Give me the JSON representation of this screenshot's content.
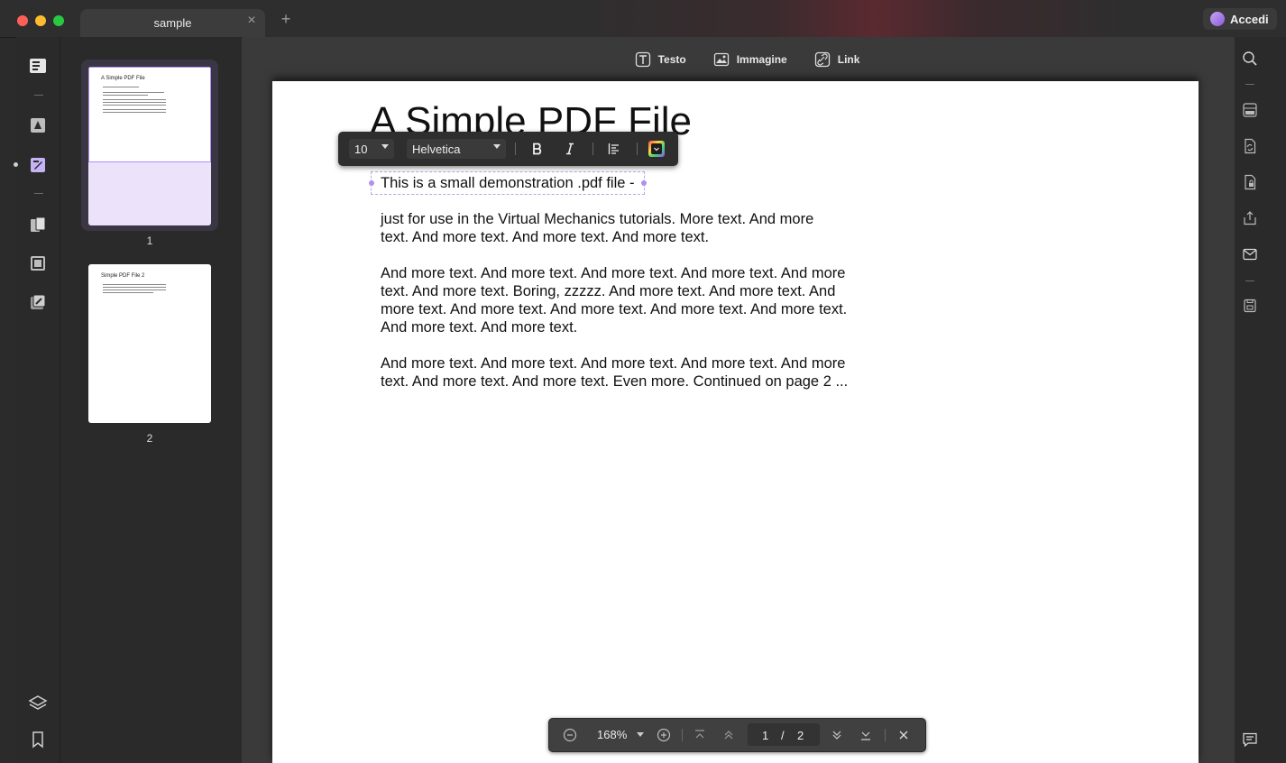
{
  "window": {
    "tab_title": "sample",
    "login_label": "Accedi"
  },
  "toolbar": {
    "text_label": "Testo",
    "image_label": "Immagine",
    "link_label": "Link"
  },
  "thumbnails": [
    {
      "number": "1",
      "title": "A Simple PDF File"
    },
    {
      "number": "2",
      "title": "Simple PDF File 2"
    }
  ],
  "format_bar": {
    "font_size": "10",
    "font_family": "Helvetica",
    "accent_color": "#e040fb"
  },
  "document": {
    "title": "A Simple PDF File",
    "selected_line": "This is a small demonstration .pdf file -",
    "paragraph1_line1": "just for use in the Virtual Mechanics tutorials. More text. And more",
    "paragraph1_line2": "text. And more text. And more text. And more text.",
    "paragraph2_line1": "And more text. And more text. And more text. And more text. And more",
    "paragraph2_line2": "text. And more text. Boring, zzzzz. And more text. And more text. And",
    "paragraph2_line3": "more text. And more text. And more text. And more text. And more text.",
    "paragraph2_line4": "And more text. And more text.",
    "paragraph3_line1": "And more text. And more text. And more text. And more text. And more",
    "paragraph3_line2": "text. And more text. And more text. Even more. Continued on page 2 ..."
  },
  "navigation": {
    "zoom": "168%",
    "current_page": "1",
    "separator": "/",
    "total_pages": "2"
  },
  "colors": {
    "selection": "#b28ef0",
    "thumb_selected_bg": "#ece3fb"
  }
}
